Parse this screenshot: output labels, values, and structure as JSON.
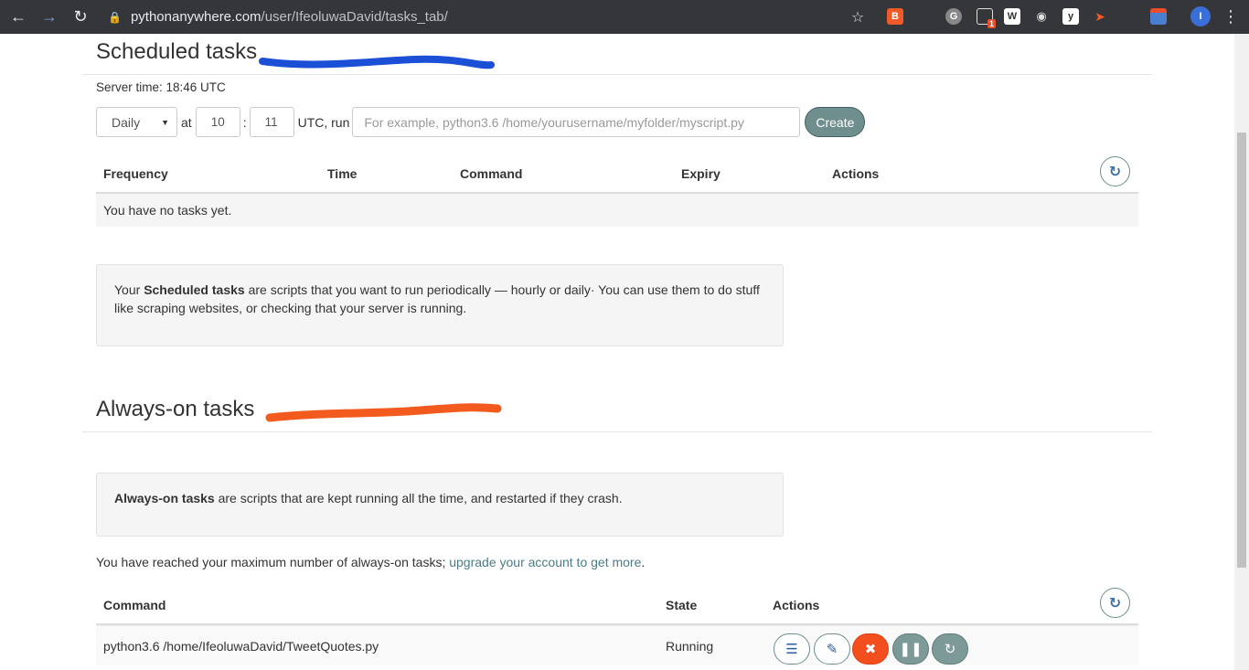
{
  "browser": {
    "url_host": "pythonanywhere.com",
    "url_path": "/user/IfeoluwaDavid/tasks_tab/",
    "extension_badge": "1"
  },
  "scheduled": {
    "title": "Scheduled tasks",
    "server_time": "Server time: 18:46 UTC",
    "frequency": "Daily",
    "at_label": "at",
    "hour": "10",
    "colon": ":",
    "minute": "11",
    "utc_run_label": "UTC, run",
    "command_placeholder": "For example, python3.6 /home/yourusername/myfolder/myscript.py",
    "create_label": "Create",
    "columns": [
      "Frequency",
      "Time",
      "Command",
      "Expiry",
      "Actions"
    ],
    "empty_text": "You have no tasks yet.",
    "info_prefix": "Your ",
    "info_bold": "Scheduled tasks",
    "info_rest": " are scripts that you want to run periodically — hourly or daily· You can use them to do stuff like scraping websites, or checking that your server is running."
  },
  "always_on": {
    "title": "Always-on tasks",
    "info_bold": "Always-on tasks",
    "info_rest": " are scripts that are kept running all the time, and restarted if they crash.",
    "max_note_prefix": "You have reached your maximum number of always-on tasks; ",
    "max_note_link": "upgrade your account to get more",
    "max_note_suffix": ".",
    "columns": [
      "Command",
      "State",
      "Actions"
    ],
    "rows": [
      {
        "command": "python3.6 /home/IfeoluwaDavid/TweetQuotes.py",
        "state": "Running"
      }
    ]
  },
  "colors": {
    "accent": "#6e8f8e",
    "danger": "#f24e1e",
    "link": "#4a7c88",
    "scribble_blue": "#1a4fd6",
    "scribble_orange": "#f25a1e"
  }
}
